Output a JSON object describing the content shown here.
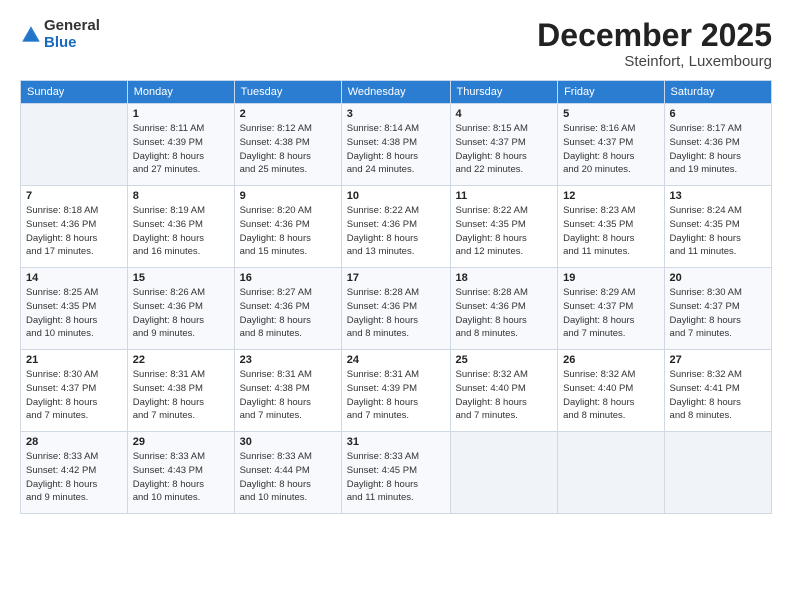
{
  "logo": {
    "general": "General",
    "blue": "Blue"
  },
  "header": {
    "title": "December 2025",
    "location": "Steinfort, Luxembourg"
  },
  "days": [
    "Sunday",
    "Monday",
    "Tuesday",
    "Wednesday",
    "Thursday",
    "Friday",
    "Saturday"
  ],
  "weeks": [
    [
      {
        "num": "",
        "info": ""
      },
      {
        "num": "1",
        "info": "Sunrise: 8:11 AM\nSunset: 4:39 PM\nDaylight: 8 hours\nand 27 minutes."
      },
      {
        "num": "2",
        "info": "Sunrise: 8:12 AM\nSunset: 4:38 PM\nDaylight: 8 hours\nand 25 minutes."
      },
      {
        "num": "3",
        "info": "Sunrise: 8:14 AM\nSunset: 4:38 PM\nDaylight: 8 hours\nand 24 minutes."
      },
      {
        "num": "4",
        "info": "Sunrise: 8:15 AM\nSunset: 4:37 PM\nDaylight: 8 hours\nand 22 minutes."
      },
      {
        "num": "5",
        "info": "Sunrise: 8:16 AM\nSunset: 4:37 PM\nDaylight: 8 hours\nand 20 minutes."
      },
      {
        "num": "6",
        "info": "Sunrise: 8:17 AM\nSunset: 4:36 PM\nDaylight: 8 hours\nand 19 minutes."
      }
    ],
    [
      {
        "num": "7",
        "info": "Sunrise: 8:18 AM\nSunset: 4:36 PM\nDaylight: 8 hours\nand 17 minutes."
      },
      {
        "num": "8",
        "info": "Sunrise: 8:19 AM\nSunset: 4:36 PM\nDaylight: 8 hours\nand 16 minutes."
      },
      {
        "num": "9",
        "info": "Sunrise: 8:20 AM\nSunset: 4:36 PM\nDaylight: 8 hours\nand 15 minutes."
      },
      {
        "num": "10",
        "info": "Sunrise: 8:22 AM\nSunset: 4:36 PM\nDaylight: 8 hours\nand 13 minutes."
      },
      {
        "num": "11",
        "info": "Sunrise: 8:22 AM\nSunset: 4:35 PM\nDaylight: 8 hours\nand 12 minutes."
      },
      {
        "num": "12",
        "info": "Sunrise: 8:23 AM\nSunset: 4:35 PM\nDaylight: 8 hours\nand 11 minutes."
      },
      {
        "num": "13",
        "info": "Sunrise: 8:24 AM\nSunset: 4:35 PM\nDaylight: 8 hours\nand 11 minutes."
      }
    ],
    [
      {
        "num": "14",
        "info": "Sunrise: 8:25 AM\nSunset: 4:35 PM\nDaylight: 8 hours\nand 10 minutes."
      },
      {
        "num": "15",
        "info": "Sunrise: 8:26 AM\nSunset: 4:36 PM\nDaylight: 8 hours\nand 9 minutes."
      },
      {
        "num": "16",
        "info": "Sunrise: 8:27 AM\nSunset: 4:36 PM\nDaylight: 8 hours\nand 8 minutes."
      },
      {
        "num": "17",
        "info": "Sunrise: 8:28 AM\nSunset: 4:36 PM\nDaylight: 8 hours\nand 8 minutes."
      },
      {
        "num": "18",
        "info": "Sunrise: 8:28 AM\nSunset: 4:36 PM\nDaylight: 8 hours\nand 8 minutes."
      },
      {
        "num": "19",
        "info": "Sunrise: 8:29 AM\nSunset: 4:37 PM\nDaylight: 8 hours\nand 7 minutes."
      },
      {
        "num": "20",
        "info": "Sunrise: 8:30 AM\nSunset: 4:37 PM\nDaylight: 8 hours\nand 7 minutes."
      }
    ],
    [
      {
        "num": "21",
        "info": "Sunrise: 8:30 AM\nSunset: 4:37 PM\nDaylight: 8 hours\nand 7 minutes."
      },
      {
        "num": "22",
        "info": "Sunrise: 8:31 AM\nSunset: 4:38 PM\nDaylight: 8 hours\nand 7 minutes."
      },
      {
        "num": "23",
        "info": "Sunrise: 8:31 AM\nSunset: 4:38 PM\nDaylight: 8 hours\nand 7 minutes."
      },
      {
        "num": "24",
        "info": "Sunrise: 8:31 AM\nSunset: 4:39 PM\nDaylight: 8 hours\nand 7 minutes."
      },
      {
        "num": "25",
        "info": "Sunrise: 8:32 AM\nSunset: 4:40 PM\nDaylight: 8 hours\nand 7 minutes."
      },
      {
        "num": "26",
        "info": "Sunrise: 8:32 AM\nSunset: 4:40 PM\nDaylight: 8 hours\nand 8 minutes."
      },
      {
        "num": "27",
        "info": "Sunrise: 8:32 AM\nSunset: 4:41 PM\nDaylight: 8 hours\nand 8 minutes."
      }
    ],
    [
      {
        "num": "28",
        "info": "Sunrise: 8:33 AM\nSunset: 4:42 PM\nDaylight: 8 hours\nand 9 minutes."
      },
      {
        "num": "29",
        "info": "Sunrise: 8:33 AM\nSunset: 4:43 PM\nDaylight: 8 hours\nand 10 minutes."
      },
      {
        "num": "30",
        "info": "Sunrise: 8:33 AM\nSunset: 4:44 PM\nDaylight: 8 hours\nand 10 minutes."
      },
      {
        "num": "31",
        "info": "Sunrise: 8:33 AM\nSunset: 4:45 PM\nDaylight: 8 hours\nand 11 minutes."
      },
      {
        "num": "",
        "info": ""
      },
      {
        "num": "",
        "info": ""
      },
      {
        "num": "",
        "info": ""
      }
    ]
  ]
}
